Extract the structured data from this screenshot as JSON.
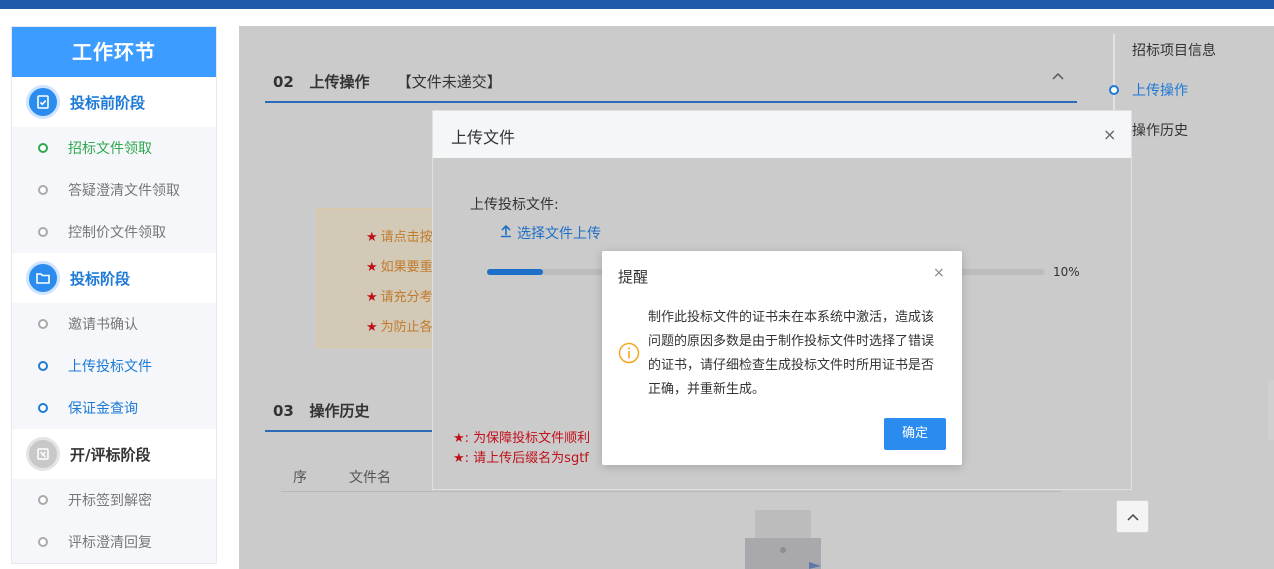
{
  "sidebar": {
    "title": "工作环节",
    "stage1": {
      "label": "投标前阶段",
      "steps": [
        "招标文件领取",
        "答疑澄清文件领取",
        "控制价文件领取"
      ]
    },
    "stage2": {
      "label": "投标阶段",
      "steps": [
        "邀请书确认",
        "上传投标文件",
        "保证金查询"
      ]
    },
    "stage3": {
      "label": "开/评标阶段",
      "steps": [
        "开标签到解密",
        "评标澄清回复"
      ]
    }
  },
  "main": {
    "sec02": {
      "num": "02",
      "title": "上传操作",
      "status": "【文件未递交】"
    },
    "notices": [
      "请点击按",
      "如果要重",
      "请充分考",
      "为防止各"
    ],
    "notice_star": "★",
    "sec03": {
      "num": "03",
      "title": "操作历史"
    },
    "table": {
      "col_index": "序",
      "col_filename": "文件名"
    }
  },
  "anchor_nav": {
    "items": [
      "招标项目信息",
      "上传操作",
      "操作历史"
    ],
    "active": "上传操作"
  },
  "upload_dialog": {
    "title": "上传文件",
    "field_label": "上传投标文件:",
    "upload_link": "选择文件上传",
    "progress": 10,
    "progress_text": "10%",
    "warnings": [
      "★: 为保障投标文件顺利",
      "★: 请上传后缀名为sgtf"
    ]
  },
  "alert_dialog": {
    "title": "提醒",
    "message": "制作此投标文件的证书未在本系统中激活，造成该问题的原因多数是由于制作投标文件时选择了错误的证书，请仔细检查生成投标文件时所用证书是否正确，并重新生成。",
    "ok_label": "确定"
  },
  "colors": {
    "topbar": "#1e5aa8",
    "sidebar_header": "#3d9cff",
    "accent": "#2b8cf0",
    "warning_icon": "#f5a623"
  },
  "icons": [
    "clipboard-check-icon",
    "folder-icon",
    "gavel-icon",
    "chevron-up-icon",
    "close-icon",
    "upload-icon",
    "info-circle-icon",
    "printer-icon"
  ]
}
